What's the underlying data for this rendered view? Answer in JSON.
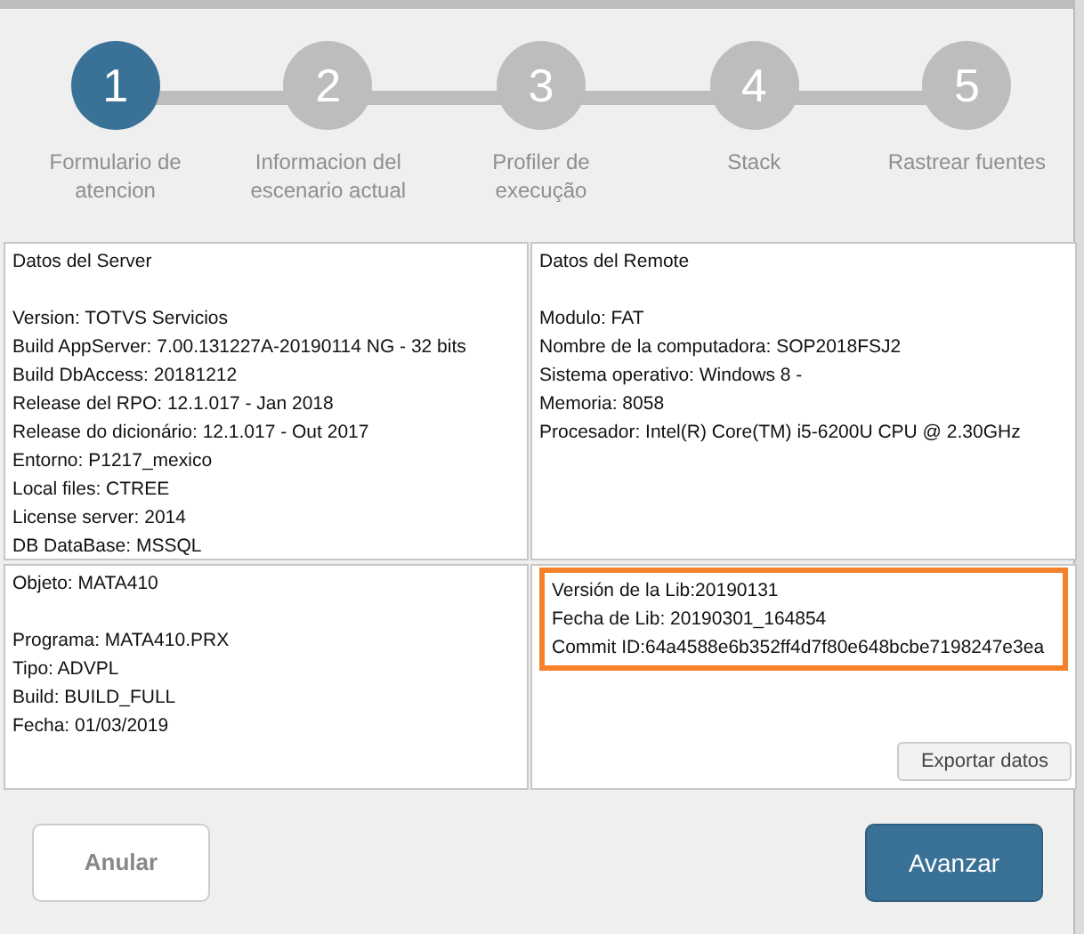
{
  "steps": [
    {
      "number": "1",
      "label": "Formulario de atencion",
      "selected": true
    },
    {
      "number": "2",
      "label": "Informacion del escenario actual",
      "selected": false
    },
    {
      "number": "3",
      "label": "Profiler de execução",
      "selected": false
    },
    {
      "number": "4",
      "label": "Stack",
      "selected": false
    },
    {
      "number": "5",
      "label": "Rastrear fuentes",
      "selected": false
    }
  ],
  "panels": [
    {
      "title": "Datos del Server",
      "highlighted": false,
      "lines": [
        "Version: TOTVS Servicios",
        "Build AppServer: 7.00.131227A-20190114 NG - 32 bits",
        "Build DbAccess: 20181212",
        "Release del RPO:  12.1.017 - Jan  2018",
        "Release do dicionário: 12.1.017 - Out  2017",
        "Entorno: P1217_mexico",
        "Local files: CTREE",
        "License server: 2014",
        "DB DataBase: MSSQL"
      ]
    },
    {
      "title": "Datos del Remote",
      "highlighted": false,
      "lines": [
        "Modulo: FAT",
        "Nombre de la computadora: SOP2018FSJ2",
        "Sistema operativo: Windows 8 -",
        "Memoria: 8058",
        "Procesador: Intel(R) Core(TM) i5-6200U CPU @ 2.30GHz"
      ]
    },
    {
      "title": "Objeto: MATA410",
      "highlighted": false,
      "lines": [
        "Programa: MATA410.PRX",
        "Tipo: ADVPL",
        "Build: BUILD_FULL",
        "Fecha: 01/03/2019"
      ]
    },
    {
      "highlighted": true,
      "lines": [
        "Versión de la Lib:20190131",
        "Fecha de Lib: 20190301_164854",
        "Commit ID:64a4588e6b352ff4d7f80e648bcbe7198247e3ea"
      ]
    }
  ],
  "export_button": "Exportar datos",
  "cancel_button": "Anular",
  "next_button": "Avanzar"
}
